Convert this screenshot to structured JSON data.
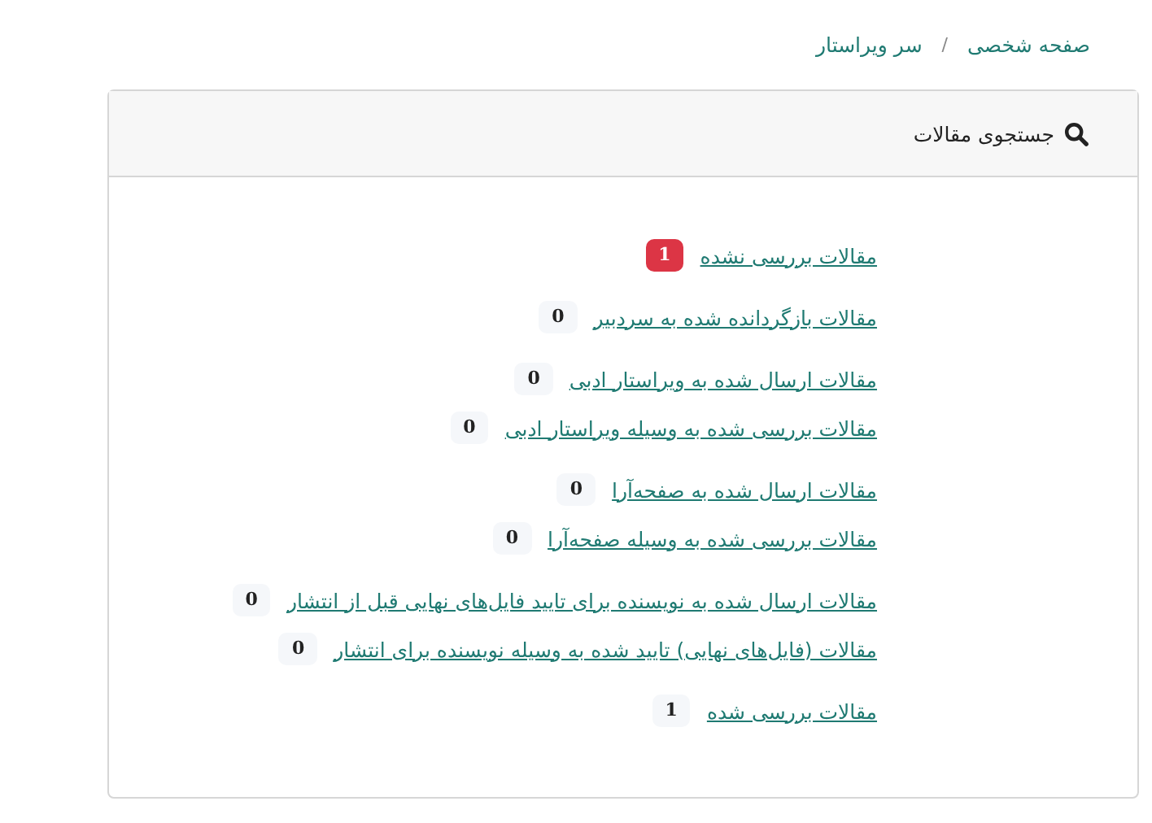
{
  "breadcrumb": [
    {
      "label": "صفحه شخصی"
    },
    {
      "label": "سر ویراستار"
    }
  ],
  "breadcrumb_separator": "/",
  "card": {
    "title": "جستجوی مقالات",
    "groups": [
      {
        "items": [
          {
            "label": "مقالات بررسی نشده",
            "count": "1",
            "color": "#dc3545"
          }
        ]
      },
      {
        "items": [
          {
            "label": "مقالات بازگردانده شده به سردبیر",
            "count": "0",
            "color": "#f5f7fa"
          }
        ]
      },
      {
        "items": [
          {
            "label": "مقالات ارسال شده به ویراستار ادبی",
            "count": "0",
            "color": "#f5f7fa"
          },
          {
            "label": "مقالات بررسی شده به وسیله ویراستار ادبی",
            "count": "0",
            "color": "#f5f7fa"
          }
        ]
      },
      {
        "items": [
          {
            "label": "مقالات ارسال شده به صفحه‌آرا",
            "count": "0",
            "color": "#f5f7fa"
          },
          {
            "label": "مقالات بررسی شده به وسیله صفحه‌آرا",
            "count": "0",
            "color": "#f5f7fa"
          }
        ]
      },
      {
        "items": [
          {
            "label": "مقالات ارسال شده به نویسنده برای تایید فایل‌های نهایی قبل از انتشار",
            "count": "0",
            "color": "#f5f7fa"
          },
          {
            "label": "مقالات (فایل‌های نهایی) تایید شده به وسیله نویسنده برای انتشار",
            "count": "0",
            "color": "#f5f7fa"
          }
        ]
      },
      {
        "items": [
          {
            "label": "مقالات بررسی شده",
            "count": "1",
            "color": "#f5f7fa"
          }
        ]
      }
    ]
  }
}
